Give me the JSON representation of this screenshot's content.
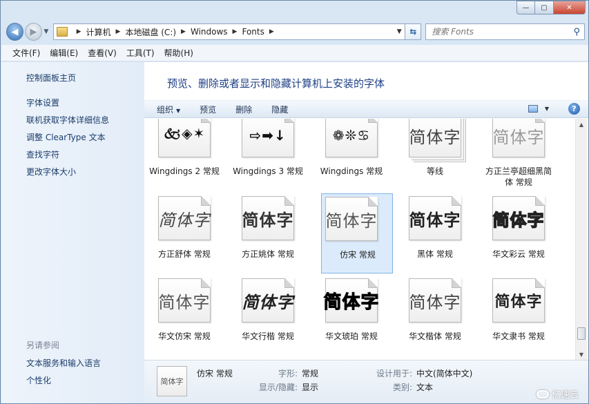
{
  "window": {
    "caption_buttons": {
      "minimize": "—",
      "maximize": "▢",
      "close": "✕"
    }
  },
  "address_bar": {
    "breadcrumbs": [
      "计算机",
      "本地磁盘 (C:)",
      "Windows",
      "Fonts"
    ],
    "search_placeholder": "搜索 Fonts"
  },
  "menu": [
    "文件(F)",
    "编辑(E)",
    "查看(V)",
    "工具(T)",
    "帮助(H)"
  ],
  "sidebar": {
    "top_links": [
      "控制面板主页",
      "字体设置",
      "联机获取字体详细信息",
      "调整 ClearType 文本",
      "查找字符",
      "更改字体大小"
    ],
    "see_also_heading": "另请参阅",
    "see_also_links": [
      "文本服务和输入语言",
      "个性化"
    ]
  },
  "main": {
    "title": "预览、删除或者显示和隐藏计算机上安装的字体",
    "toolbar": {
      "organize": "组织",
      "preview": "预览",
      "delete": "删除",
      "hide": "隐藏"
    }
  },
  "fonts": [
    {
      "name": "Wingdings 2 常规",
      "sample": "🙵◈✶"
    },
    {
      "name": "Wingdings 3 常规",
      "sample": "⇨➡↓"
    },
    {
      "name": "Wingdings 常规",
      "sample": "❁❊♋"
    },
    {
      "name": "等线",
      "sample": "简体字"
    },
    {
      "name": "方正兰亭超细黑简体 常规",
      "sample": "简体字"
    },
    {
      "name": "方正舒体 常规",
      "sample": "简体字"
    },
    {
      "name": "方正姚体 常规",
      "sample": "简体字"
    },
    {
      "name": "仿宋 常规",
      "sample": "简体字"
    },
    {
      "name": "黑体 常规",
      "sample": "简体字"
    },
    {
      "name": "华文彩云 常规",
      "sample": "简体字"
    },
    {
      "name": "华文仿宋 常规",
      "sample": "简体字"
    },
    {
      "name": "华文行楷 常规",
      "sample": "简体字"
    },
    {
      "name": "华文琥珀 常规",
      "sample": "简体字"
    },
    {
      "name": "华文楷体 常规",
      "sample": "简体字"
    },
    {
      "name": "华文隶书 常规",
      "sample": "简体字"
    }
  ],
  "details": {
    "thumb_sample": "简体字",
    "name": "仿宋 常规",
    "style_label": "字形:",
    "style_value": "常规",
    "visibility_label": "显示/隐藏:",
    "visibility_value": "显示",
    "designed_for_label": "设计用于:",
    "designed_for_value": "中文(简体中文)",
    "category_label": "类别:",
    "category_value": "文本"
  },
  "watermark": "亿速云"
}
